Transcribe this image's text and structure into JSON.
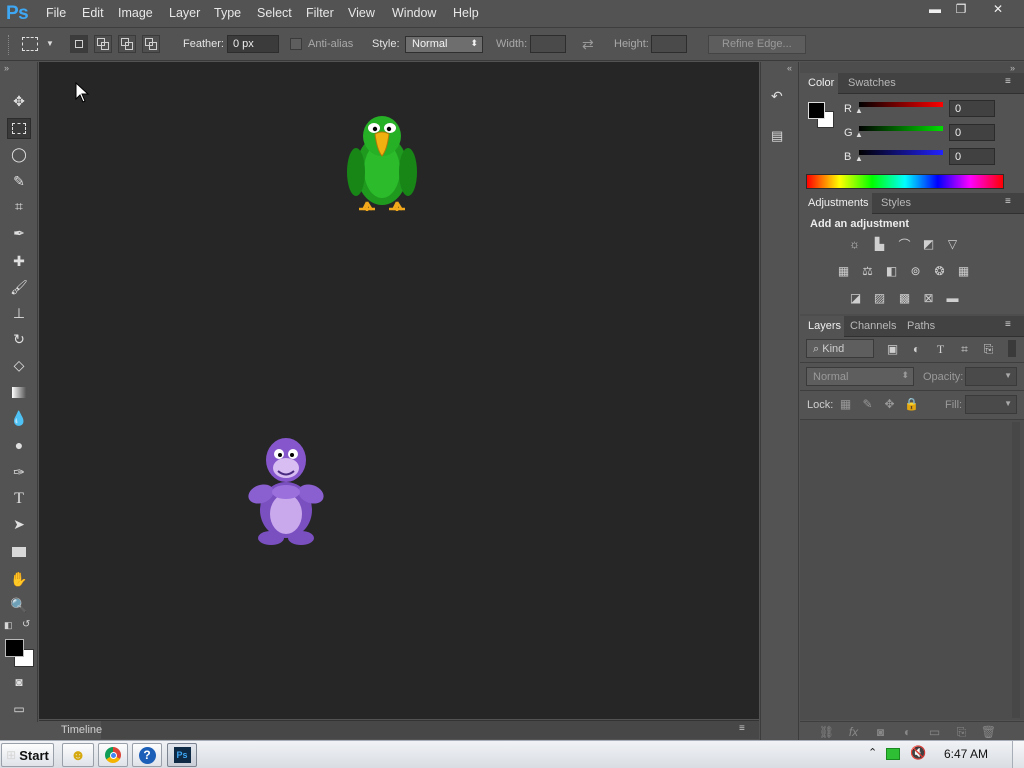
{
  "app": {
    "logo": "Ps"
  },
  "menu": [
    "File",
    "Edit",
    "Image",
    "Layer",
    "Type",
    "Select",
    "Filter",
    "View",
    "Window",
    "Help"
  ],
  "window_controls": {
    "minimize": "▬",
    "restore": "❐",
    "close": "✕"
  },
  "options": {
    "feather_label": "Feather:",
    "feather_value": "0 px",
    "antialias_label": "Anti-alias",
    "style_label": "Style:",
    "style_value": "Normal",
    "width_label": "Width:",
    "height_label": "Height:",
    "refine_edge": "Refine Edge..."
  },
  "tools": [
    "move-tool",
    "marquee-tool",
    "lasso-tool",
    "quick-select-tool",
    "crop-tool",
    "eyedropper-tool",
    "healing-brush-tool",
    "brush-tool",
    "clone-stamp-tool",
    "history-brush-tool",
    "eraser-tool",
    "gradient-tool",
    "blur-tool",
    "dodge-tool",
    "pen-tool",
    "type-tool",
    "path-select-tool",
    "rectangle-tool",
    "hand-tool",
    "zoom-tool"
  ],
  "canvas": {
    "bg_color": "#262626",
    "characters": [
      "green-parrot",
      "purple-gorilla"
    ]
  },
  "timeline": {
    "label": "Timeline"
  },
  "color_panel": {
    "tabs": [
      "Color",
      "Swatches"
    ],
    "r_label": "R",
    "g_label": "G",
    "b_label": "B",
    "r_value": "0",
    "g_value": "0",
    "b_value": "0",
    "foreground": "#000000",
    "background": "#ffffff"
  },
  "adjustments_panel": {
    "tabs": [
      "Adjustments",
      "Styles"
    ],
    "heading": "Add an adjustment"
  },
  "layers_panel": {
    "tabs": [
      "Layers",
      "Channels",
      "Paths"
    ],
    "kind_label": "Kind",
    "blend_mode": "Normal",
    "opacity_label": "Opacity:",
    "lock_label": "Lock:",
    "fill_label": "Fill:"
  },
  "taskbar": {
    "start_label": "Start",
    "time": "6:47 AM"
  }
}
